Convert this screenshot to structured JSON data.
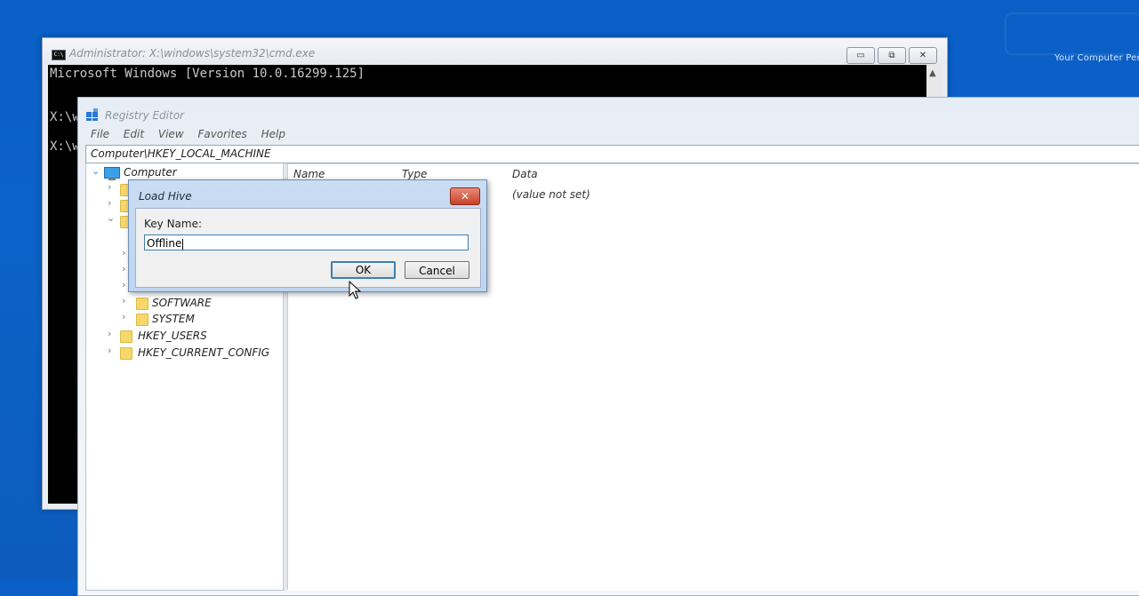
{
  "watermark": {
    "tagline": "Your Computer Per"
  },
  "cmd": {
    "title": "Administrator: X:\\windows\\system32\\cmd.exe",
    "lines": [
      "Microsoft Windows [Version 10.0.16299.125]",
      "X:\\w",
      "X:\\w"
    ],
    "buttons": {
      "minimize": "▭",
      "restore": "⧉",
      "close": "✕"
    }
  },
  "registry": {
    "title": "Registry Editor",
    "menu": [
      "File",
      "Edit",
      "View",
      "Favorites",
      "Help"
    ],
    "address": "Computer\\HKEY_LOCAL_MACHINE",
    "tree": {
      "root": "Computer",
      "software": "SOFTWARE",
      "system": "SYSTEM",
      "users": "HKEY_USERS",
      "current_config": "HKEY_CURRENT_CONFIG"
    },
    "columns": {
      "name": "Name",
      "type": "Type",
      "data": "Data"
    },
    "row_data": "(value not set)"
  },
  "dialog": {
    "title": "Load Hive",
    "close_glyph": "✕",
    "key_label": "Key Name:",
    "key_value": "Offline",
    "ok_label": "OK",
    "cancel_label": "Cancel"
  },
  "icons": {
    "cmd": "command-prompt-icon",
    "registry": "registry-editor-icon",
    "folder": "folder-icon",
    "computer": "computer-icon",
    "cursor": "mouse-pointer-icon"
  }
}
